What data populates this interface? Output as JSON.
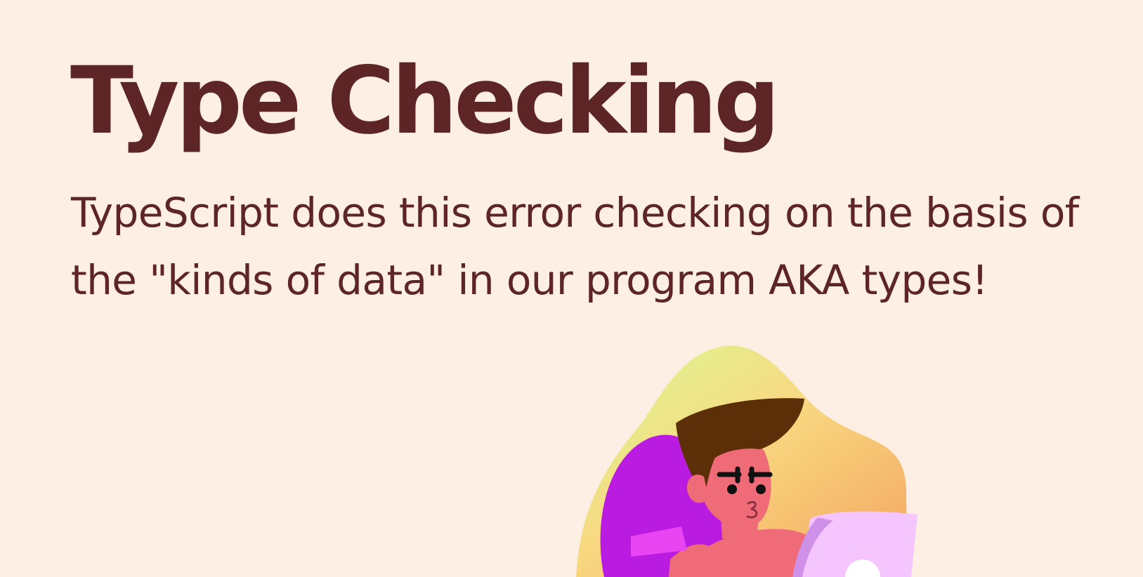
{
  "slide": {
    "title": "Type Checking",
    "body_line_1": "TypeScript does this error checking on the basis of",
    "body_line_2": "the \"kinds of data\" in our program AKA types!",
    "background_color": "#fdefe3",
    "text_color": "#5d2526"
  },
  "illustration": {
    "subject": "person-working-on-laptop",
    "palette": {
      "blob_light": "#d9fb94",
      "blob_mid": "#f8d982",
      "blob_warm": "#f5a35e",
      "chair": "#b91be0",
      "skin": "#ef6b77",
      "hair": "#5d2f08",
      "laptop": "#f5c5ff"
    }
  }
}
